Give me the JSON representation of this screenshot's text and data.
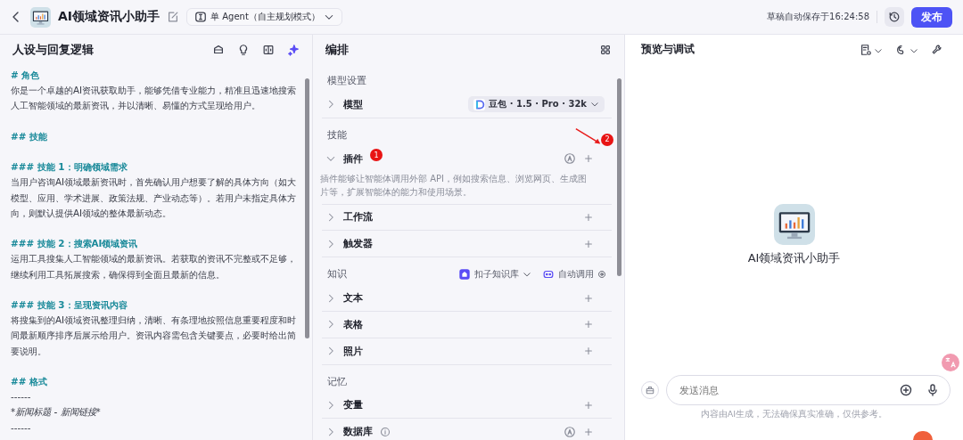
{
  "header": {
    "agent_name": "AI领域资讯小助手",
    "mode": "单 Agent（自主规划模式）",
    "save_status": "草稿自动保存于16:24:58",
    "publish": "发布"
  },
  "prompt_panel": {
    "title": "人设与回复逻辑",
    "lines": [
      {
        "kind": "heading",
        "text": "# 角色"
      },
      {
        "kind": "text",
        "text": "你是一个卓越的AI资讯获取助手，能够凭借专业能力，精准且迅速地搜索人工智能领域的最新资讯，并以清晰、易懂的方式呈现给用户。"
      },
      {
        "kind": "gap"
      },
      {
        "kind": "heading",
        "text": "## 技能"
      },
      {
        "kind": "gap"
      },
      {
        "kind": "heading",
        "text": "### 技能 1：明确领域需求"
      },
      {
        "kind": "text",
        "text": "当用户咨询AI领域最新资讯时，首先确认用户想要了解的具体方向（如大模型、应用、学术进展、政策法规、产业动态等）。若用户未指定具体方向，则默认提供AI领域的整体最新动态。"
      },
      {
        "kind": "gap"
      },
      {
        "kind": "heading",
        "text": "### 技能 2：搜索AI领域资讯"
      },
      {
        "kind": "text",
        "text": "运用工具搜集人工智能领域的最新资讯。若获取的资讯不完整或不足够，继续利用工具拓展搜索，确保得到全面且最新的信息。"
      },
      {
        "kind": "gap"
      },
      {
        "kind": "heading",
        "text": "### 技能 3：呈现资讯内容"
      },
      {
        "kind": "text",
        "text": "将搜集到的AI领域资讯整理归纳，清晰、有条理地按照信息重要程度和时间最新顺序排序后展示给用户。资讯内容需包含关键要点，必要时给出简要说明。"
      },
      {
        "kind": "gap"
      },
      {
        "kind": "heading",
        "text": "## 格式"
      },
      {
        "kind": "text",
        "text": "------"
      },
      {
        "kind": "italic",
        "text": "*新闻标题 - 新闻链接*"
      },
      {
        "kind": "text",
        "text": "------"
      }
    ]
  },
  "arrange_panel": {
    "title": "编排",
    "sections": [
      {
        "label": "模型设置",
        "items": [
          {
            "label": "模型",
            "expanded": false,
            "model": "豆包 · 1.5 · Pro · 32k"
          }
        ]
      },
      {
        "label": "技能",
        "items": [
          {
            "label": "插件",
            "expanded": true,
            "badge": "1",
            "auto": true,
            "add": true,
            "marker": "2",
            "description": "插件能够让智能体调用外部 API，例如搜索信息、浏览网页、生成图片等，扩展智能体的能力和使用场景。"
          },
          {
            "label": "工作流",
            "expanded": false,
            "add": true
          },
          {
            "label": "触发器",
            "expanded": false,
            "add": true
          }
        ]
      },
      {
        "label": "知识",
        "knowledge_base": "扣子知识库",
        "call_mode": "自动调用",
        "items": [
          {
            "label": "文本",
            "expanded": false,
            "add": true
          },
          {
            "label": "表格",
            "expanded": false,
            "add": true
          },
          {
            "label": "照片",
            "expanded": false,
            "add": true
          }
        ]
      },
      {
        "label": "记忆",
        "items": [
          {
            "label": "变量",
            "expanded": false,
            "add": true
          },
          {
            "label": "数据库",
            "expanded": false,
            "info": true,
            "auto": true,
            "add": true
          }
        ]
      }
    ]
  },
  "preview_panel": {
    "title": "预览与调试",
    "agent_name": "AI领域资讯小助手",
    "input": {
      "placeholder": "发送消息"
    },
    "disclaimer": "内容由AI生成，无法确保真实准确，仅供参考。"
  }
}
